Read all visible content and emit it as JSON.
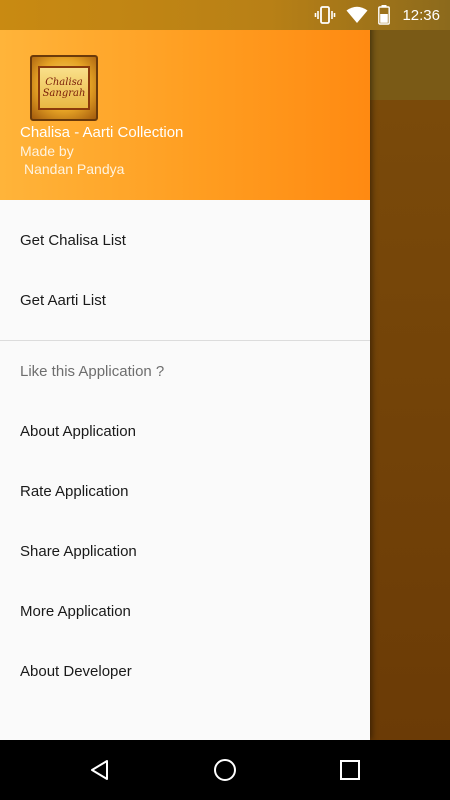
{
  "status_bar": {
    "time": "12:36",
    "icons": [
      "vibrate-icon",
      "wifi-icon",
      "battery-icon"
    ]
  },
  "drawer": {
    "header": {
      "logo_text_line1": "Chalisa",
      "logo_text_line2": "Sangrah",
      "app_title": "Chalisa - Aarti Collection",
      "made_by": "Made by",
      "author": "Nandan Pandya"
    },
    "primary_items": [
      {
        "label": "Get Chalisa List"
      },
      {
        "label": "Get Aarti List"
      }
    ],
    "section_header": "Like this Application ?",
    "secondary_items": [
      {
        "label": "About Application"
      },
      {
        "label": "Rate Application"
      },
      {
        "label": "Share Application"
      },
      {
        "label": "More Application"
      },
      {
        "label": "About Developer"
      }
    ]
  },
  "nav_bar": {
    "icons": [
      "back-icon",
      "home-icon",
      "recents-icon"
    ]
  },
  "colors": {
    "header_gradient_start": "#ffb43a",
    "header_gradient_end": "#ff8a12",
    "drawer_background": "#fafafa",
    "section_header_text": "#6e6e6e"
  }
}
